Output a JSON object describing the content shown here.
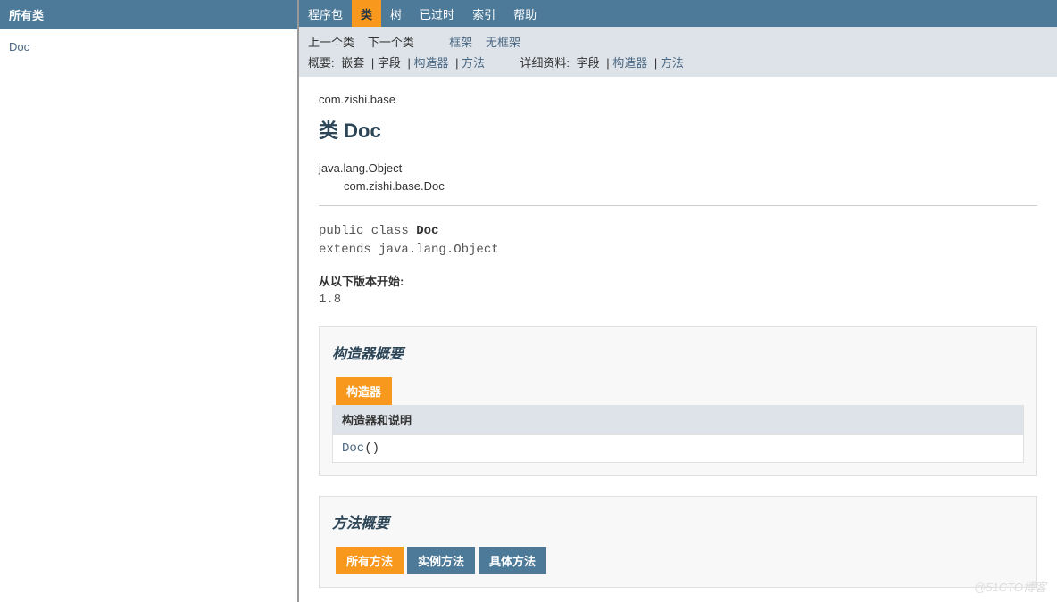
{
  "left": {
    "title": "所有类",
    "items": [
      "Doc"
    ]
  },
  "topnav": {
    "items": [
      {
        "label": "程序包",
        "active": false
      },
      {
        "label": "类",
        "active": true
      },
      {
        "label": "树",
        "active": false
      },
      {
        "label": "已过时",
        "active": false
      },
      {
        "label": "索引",
        "active": false
      },
      {
        "label": "帮助",
        "active": false
      }
    ]
  },
  "subnav": {
    "prev": "上一个类",
    "next": "下一个类",
    "frames": "框架",
    "noframes": "无框架",
    "summary_label": "概要: ",
    "summary_nested": "嵌套",
    "summary_field": "字段",
    "summary_constr": "构造器",
    "summary_method": "方法",
    "detail_label": "详细资料: ",
    "detail_field": "字段",
    "detail_constr": "构造器",
    "detail_method": "方法"
  },
  "main": {
    "package": "com.zishi.base",
    "class_prefix": "类 ",
    "class_name": "Doc",
    "inherit1": "java.lang.Object",
    "inherit2": "com.zishi.base.Doc",
    "sig_pre": "public class ",
    "sig_name": "Doc",
    "sig_ext": "extends java.lang.Object",
    "since_label": "从以下版本开始:",
    "since_value": "1.8"
  },
  "constr": {
    "heading": "构造器概要",
    "tab": "构造器",
    "col": "构造器和说明",
    "row_link": "Doc",
    "row_tail": "()"
  },
  "methods": {
    "heading": "方法概要",
    "tabs": [
      {
        "label": "所有方法",
        "active": true
      },
      {
        "label": "实例方法",
        "active": false
      },
      {
        "label": "具体方法",
        "active": false
      }
    ]
  },
  "watermark": "@51CTO博客"
}
